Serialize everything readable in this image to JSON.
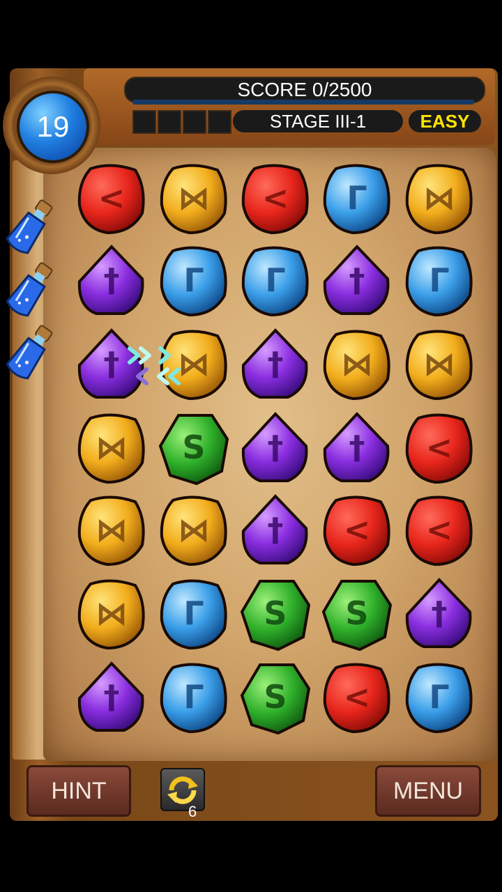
{
  "hud": {
    "score_text": "SCORE 0/2500",
    "score_progress": 0,
    "stage_text": "STAGE III-1",
    "difficulty": "EASY",
    "moves_left": "19"
  },
  "powerups": [
    {
      "name": "potion"
    },
    {
      "name": "potion"
    },
    {
      "name": "potion"
    }
  ],
  "board": {
    "rows": 7,
    "cols": 5,
    "grid": [
      [
        "red",
        "yellow",
        "red",
        "blue",
        "yellow"
      ],
      [
        "purple",
        "blue",
        "blue",
        "purple",
        "blue"
      ],
      [
        "purple",
        "yellow",
        "purple",
        "yellow",
        "yellow"
      ],
      [
        "yellow",
        "green",
        "purple",
        "purple",
        "red"
      ],
      [
        "yellow",
        "yellow",
        "purple",
        "red",
        "red"
      ],
      [
        "yellow",
        "blue",
        "green",
        "green",
        "purple"
      ],
      [
        "purple",
        "blue",
        "green",
        "red",
        "blue"
      ]
    ],
    "hint_swap": {
      "from": [
        2,
        0
      ],
      "to": [
        2,
        1
      ]
    }
  },
  "gem_colors": {
    "red": {
      "light": "#ff6a5a",
      "main": "#e8261c",
      "dark": "#8a0c08",
      "rune": "#7a0f08",
      "glyph": "<"
    },
    "yellow": {
      "light": "#ffe37a",
      "main": "#f2ad1c",
      "dark": "#9a5a08",
      "rune": "#7a4a10",
      "glyph": "⋈"
    },
    "blue": {
      "light": "#bfe8ff",
      "main": "#3a9ee8",
      "dark": "#0f4a8a",
      "rune": "#124a86",
      "glyph": "Γ"
    },
    "purple": {
      "light": "#d69cff",
      "main": "#8a2ee0",
      "dark": "#3f0f86",
      "rune": "#3a0a6a",
      "glyph": "†"
    },
    "green": {
      "light": "#9cf07a",
      "main": "#2fb02a",
      "dark": "#0f5a10",
      "rune": "#0f4a0f",
      "glyph": "S"
    }
  },
  "buttons": {
    "hint_label": "HINT",
    "menu_label": "MENU",
    "shuffle_count": "6"
  }
}
